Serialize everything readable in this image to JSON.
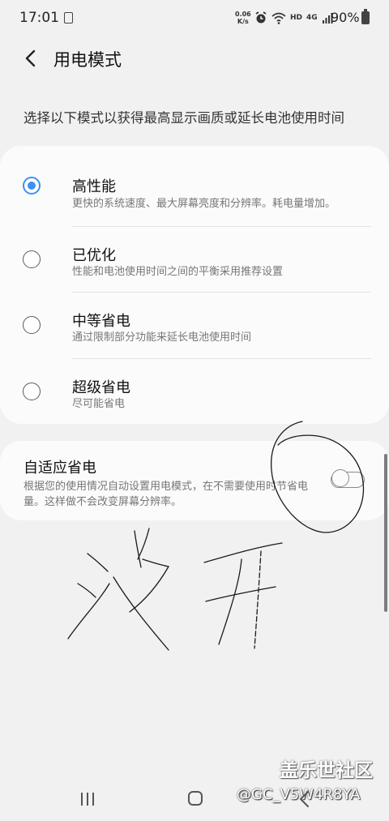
{
  "status_bar": {
    "time": "17:01",
    "net_speed_value": "0.06",
    "net_speed_unit": "K/s",
    "hd_label": "HD",
    "network_label": "4G",
    "battery_percent": "90%",
    "icons": [
      "notes-icon",
      "alarm-icon",
      "wifi-icon",
      "signal-icon",
      "battery-icon"
    ]
  },
  "header": {
    "title": "用电模式"
  },
  "description": "选择以下模式以获得最高显示画质或延长电池使用时间",
  "modes": [
    {
      "title": "高性能",
      "desc": "更快的系统速度、最大屏幕亮度和分辨率。耗电量增加。",
      "selected": true
    },
    {
      "title": "已优化",
      "desc": "性能和电池使用时间之间的平衡采用推荐设置",
      "selected": false
    },
    {
      "title": "中等省电",
      "desc": "通过限制部分功能来延长电池使用时间",
      "selected": false
    },
    {
      "title": "超级省电",
      "desc": "尽可能省电",
      "selected": false
    }
  ],
  "adaptive": {
    "title": "自适应省电",
    "desc": "根据您的使用情况自动设置用电模式，在不需要使用时节省电量。这样做不会改变屏幕分辨率。",
    "enabled": false
  },
  "colors": {
    "accent": "#3e91f0",
    "background": "#f1f1f1",
    "card": "#fbfbfb"
  },
  "watermark": {
    "brand": "盖乐世社区",
    "user": "@GC_V5W4R8YA"
  },
  "navbar": {
    "icons": [
      "recent-apps-icon",
      "home-icon",
      "back-icon"
    ]
  }
}
